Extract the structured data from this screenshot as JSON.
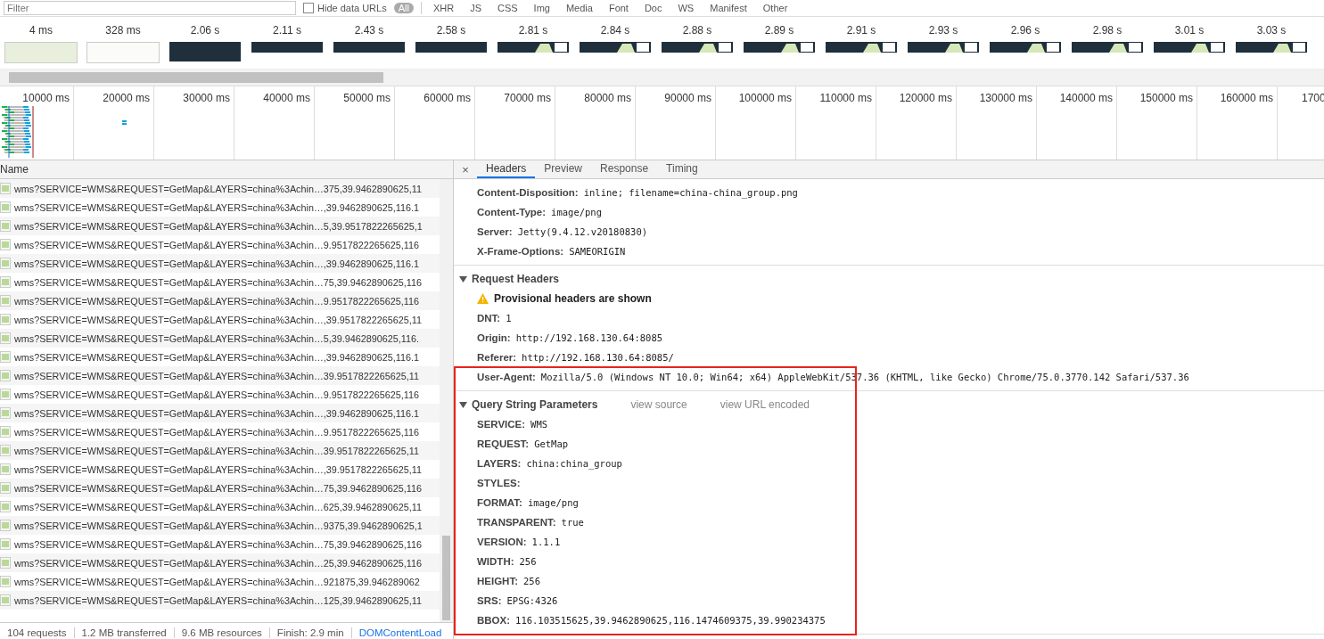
{
  "toolbar": {
    "filter_placeholder": "Filter",
    "hide_data_urls": {
      "label": "Hide data URLs",
      "checked": false
    },
    "types": [
      {
        "label": "All",
        "selected": true
      },
      {
        "label": "XHR",
        "selected": false
      },
      {
        "label": "JS",
        "selected": false
      },
      {
        "label": "CSS",
        "selected": false
      },
      {
        "label": "Img",
        "selected": false
      },
      {
        "label": "Media",
        "selected": false
      },
      {
        "label": "Font",
        "selected": false
      },
      {
        "label": "Doc",
        "selected": false
      },
      {
        "label": "WS",
        "selected": false
      },
      {
        "label": "Manifest",
        "selected": false
      },
      {
        "label": "Other",
        "selected": false
      }
    ]
  },
  "filmstrip": [
    {
      "time": "4 ms",
      "kind": "map"
    },
    {
      "time": "328 ms",
      "kind": "blank"
    },
    {
      "time": "2.06 s",
      "kind": "dark"
    },
    {
      "time": "2.11 s",
      "kind": "bar"
    },
    {
      "time": "2.43 s",
      "kind": "bar"
    },
    {
      "time": "2.58 s",
      "kind": "bar"
    },
    {
      "time": "2.81 s",
      "kind": "bar-map"
    },
    {
      "time": "2.84 s",
      "kind": "bar-map"
    },
    {
      "time": "2.88 s",
      "kind": "bar-map"
    },
    {
      "time": "2.89 s",
      "kind": "bar-map"
    },
    {
      "time": "2.91 s",
      "kind": "bar-map"
    },
    {
      "time": "2.93 s",
      "kind": "bar-map"
    },
    {
      "time": "2.96 s",
      "kind": "bar-map"
    },
    {
      "time": "2.98 s",
      "kind": "bar-map"
    },
    {
      "time": "3.01 s",
      "kind": "bar-map"
    },
    {
      "time": "3.03 s",
      "kind": "bar-map"
    }
  ],
  "timeline": {
    "ticks": [
      "10000 ms",
      "20000 ms",
      "30000 ms",
      "40000 ms",
      "50000 ms",
      "60000 ms",
      "70000 ms",
      "80000 ms",
      "90000 ms",
      "100000 ms",
      "110000 ms",
      "120000 ms",
      "130000 ms",
      "140000 ms",
      "150000 ms",
      "160000 ms",
      "1700"
    ]
  },
  "requests": {
    "column": "Name",
    "rows": [
      "wms?SERVICE=WMS&REQUEST=GetMap&LAYERS=china%3Achin…375,39.9462890625,11",
      "wms?SERVICE=WMS&REQUEST=GetMap&LAYERS=china%3Achin…,39.9462890625,116.1",
      "wms?SERVICE=WMS&REQUEST=GetMap&LAYERS=china%3Achin…5,39.9517822265625,1",
      "wms?SERVICE=WMS&REQUEST=GetMap&LAYERS=china%3Achin…9.9517822265625,116",
      "wms?SERVICE=WMS&REQUEST=GetMap&LAYERS=china%3Achin…,39.9462890625,116.1",
      "wms?SERVICE=WMS&REQUEST=GetMap&LAYERS=china%3Achin…75,39.9462890625,116",
      "wms?SERVICE=WMS&REQUEST=GetMap&LAYERS=china%3Achin…9.9517822265625,116",
      "wms?SERVICE=WMS&REQUEST=GetMap&LAYERS=china%3Achin…,39.9517822265625,11",
      "wms?SERVICE=WMS&REQUEST=GetMap&LAYERS=china%3Achin…5,39.9462890625,116.",
      "wms?SERVICE=WMS&REQUEST=GetMap&LAYERS=china%3Achin…,39.9462890625,116.1",
      "wms?SERVICE=WMS&REQUEST=GetMap&LAYERS=china%3Achin…39.9517822265625,11",
      "wms?SERVICE=WMS&REQUEST=GetMap&LAYERS=china%3Achin…9.9517822265625,116",
      "wms?SERVICE=WMS&REQUEST=GetMap&LAYERS=china%3Achin…,39.9462890625,116.1",
      "wms?SERVICE=WMS&REQUEST=GetMap&LAYERS=china%3Achin…9.9517822265625,116",
      "wms?SERVICE=WMS&REQUEST=GetMap&LAYERS=china%3Achin…39.9517822265625,11",
      "wms?SERVICE=WMS&REQUEST=GetMap&LAYERS=china%3Achin…,39.9517822265625,11",
      "wms?SERVICE=WMS&REQUEST=GetMap&LAYERS=china%3Achin…75,39.9462890625,116",
      "wms?SERVICE=WMS&REQUEST=GetMap&LAYERS=china%3Achin…625,39.9462890625,11",
      "wms?SERVICE=WMS&REQUEST=GetMap&LAYERS=china%3Achin…9375,39.9462890625,1",
      "wms?SERVICE=WMS&REQUEST=GetMap&LAYERS=china%3Achin…75,39.9462890625,116",
      "wms?SERVICE=WMS&REQUEST=GetMap&LAYERS=china%3Achin…25,39.9462890625,116",
      "wms?SERVICE=WMS&REQUEST=GetMap&LAYERS=china%3Achin…921875,39.946289062",
      "wms?SERVICE=WMS&REQUEST=GetMap&LAYERS=china%3Achin…125,39.9462890625,11"
    ]
  },
  "status_bar": [
    {
      "text": "104 requests",
      "kind": "plain"
    },
    {
      "text": "1.2 MB transferred",
      "kind": "plain"
    },
    {
      "text": "9.6 MB resources",
      "kind": "plain"
    },
    {
      "text": "Finish: 2.9 min",
      "kind": "plain"
    },
    {
      "text": "DOMContentLoad",
      "kind": "link"
    }
  ],
  "details": {
    "close_label": "×",
    "tabs": [
      {
        "label": "Headers",
        "selected": true
      },
      {
        "label": "Preview",
        "selected": false
      },
      {
        "label": "Response",
        "selected": false
      },
      {
        "label": "Timing",
        "selected": false
      }
    ],
    "response_headers": [
      {
        "name": "Content-Disposition:",
        "value": "inline; filename=china-china_group.png"
      },
      {
        "name": "Content-Type:",
        "value": "image/png"
      },
      {
        "name": "Server:",
        "value": "Jetty(9.4.12.v20180830)"
      },
      {
        "name": "X-Frame-Options:",
        "value": "SAMEORIGIN"
      }
    ],
    "request_headers": {
      "title": "Request Headers",
      "expanded": true,
      "warning": "Provisional headers are shown",
      "items": [
        {
          "name": "DNT:",
          "value": "1"
        },
        {
          "name": "Origin:",
          "value": "http://192.168.130.64:8085"
        },
        {
          "name": "Referer:",
          "value": "http://192.168.130.64:8085/"
        },
        {
          "name": "User-Agent:",
          "value": "Mozilla/5.0 (Windows NT 10.0; Win64; x64) AppleWebKit/537.36 (KHTML, like Gecko) Chrome/75.0.3770.142 Safari/537.36"
        }
      ]
    },
    "query_string": {
      "title": "Query String Parameters",
      "expanded": true,
      "links": [
        "view source",
        "view URL encoded"
      ],
      "items": [
        {
          "name": "SERVICE:",
          "value": "WMS"
        },
        {
          "name": "REQUEST:",
          "value": "GetMap"
        },
        {
          "name": "LAYERS:",
          "value": "china:china_group"
        },
        {
          "name": "STYLES:",
          "value": ""
        },
        {
          "name": "FORMAT:",
          "value": "image/png"
        },
        {
          "name": "TRANSPARENT:",
          "value": "true"
        },
        {
          "name": "VERSION:",
          "value": "1.1.1"
        },
        {
          "name": "WIDTH:",
          "value": "256"
        },
        {
          "name": "HEIGHT:",
          "value": "256"
        },
        {
          "name": "SRS:",
          "value": "EPSG:4326"
        },
        {
          "name": "BBOX:",
          "value": "116.103515625,39.9462890625,116.1474609375,39.990234375"
        }
      ]
    }
  }
}
